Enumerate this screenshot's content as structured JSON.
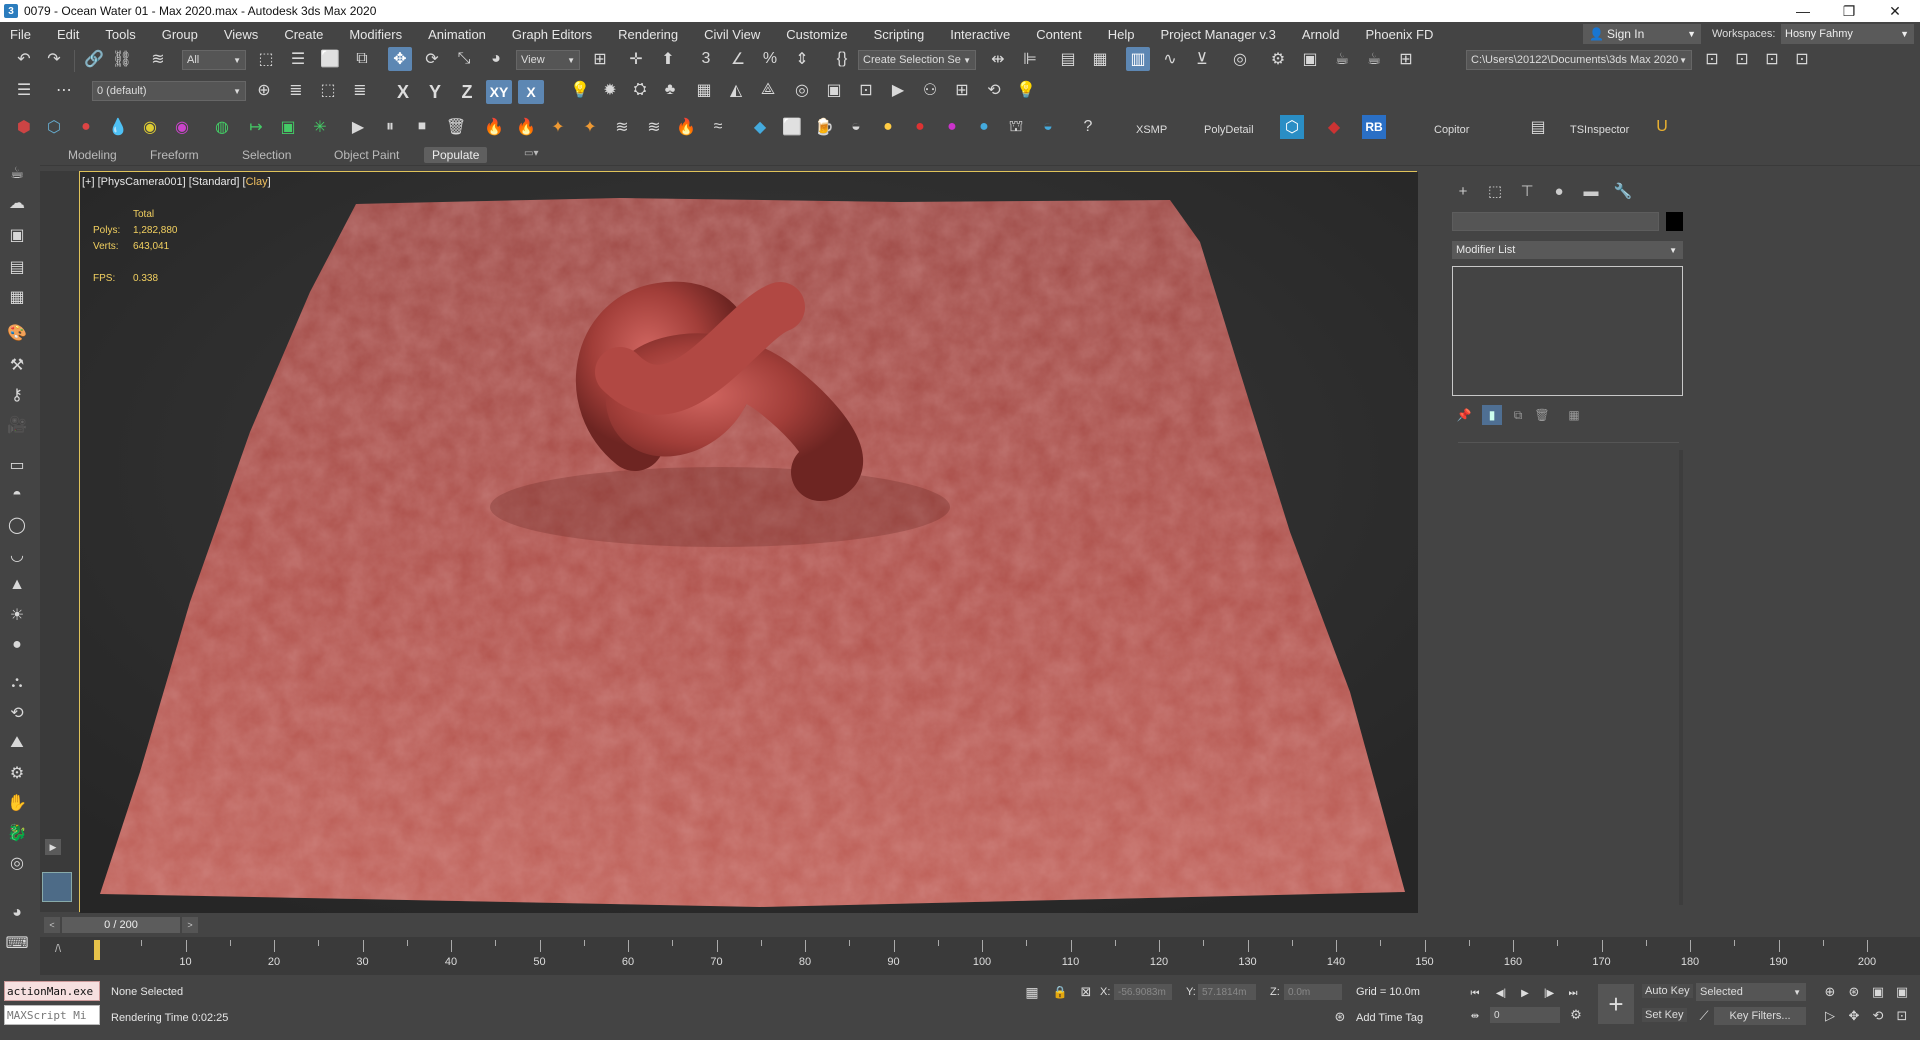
{
  "window": {
    "title": "0079 - Ocean Water 01 - Max 2020.max - Autodesk 3ds Max 2020",
    "minimize": "—",
    "maximize": "❐",
    "close": "✕"
  },
  "menu": [
    "File",
    "Edit",
    "Tools",
    "Group",
    "Views",
    "Create",
    "Modifiers",
    "Animation",
    "Graph Editors",
    "Rendering",
    "Civil View",
    "Customize",
    "Scripting",
    "Interactive",
    "Content",
    "Help",
    "Project Manager v.3",
    "Arnold",
    "Phoenix FD"
  ],
  "account": {
    "sign_in": "Sign In",
    "workspaces_label": "Workspaces:",
    "workspace_value": "Hosny Fahmy"
  },
  "main_toolbar": {
    "selection_filter": "All",
    "ref_coord": "View",
    "named_selection": "Create Selection Se",
    "project_path": "C:\\Users\\20122\\Documents\\3ds Max 2020"
  },
  "layer_toolbar": {
    "layer_name": "0 (default)",
    "axis_x": "X",
    "axis_y": "Y",
    "axis_z": "Z",
    "axis_xy": "XY",
    "axis_xz": "X"
  },
  "plugin_toolbar": {
    "xsmp": "XSMP",
    "polydetail": "PolyDetail",
    "rb": "RB",
    "copitor": "Copitor",
    "tsinspector": "TSInspector"
  },
  "ribbon_tabs": [
    "Modeling",
    "Freeform",
    "Selection",
    "Object Paint",
    "Populate"
  ],
  "ribbon_active": "Populate",
  "viewport": {
    "label_prefix": "[+] [PhysCamera001] [Standard] [",
    "label_mode": "Clay",
    "label_suffix": "]",
    "stats": {
      "header": "Total",
      "polys_label": "Polys:",
      "polys": "1,282,880",
      "verts_label": "Verts:",
      "verts": "643,041",
      "fps_label": "FPS:",
      "fps": "0.338"
    },
    "terrain_color": "#b24a45",
    "knot_color": "#a83f3a"
  },
  "command_panel": {
    "modifier_list": "Modifier List"
  },
  "timeline": {
    "slider_text": "0 / 200",
    "ticks": [
      "10",
      "20",
      "30",
      "40",
      "50",
      "60",
      "70",
      "80",
      "90",
      "100",
      "110",
      "120",
      "130",
      "140",
      "150",
      "160",
      "170",
      "180",
      "190",
      "200"
    ]
  },
  "status": {
    "maxscript_1": "actionMan.exe",
    "maxscript_2": "MAXScript Mi",
    "selection": "None Selected",
    "render_time": "Rendering Time  0:02:25",
    "x_label": "X:",
    "x_value": "-56.9083m",
    "y_label": "Y:",
    "y_value": "57.1814m",
    "z_label": "Z:",
    "z_value": "0.0m",
    "grid": "Grid = 10.0m",
    "add_time_tag": "Add Time Tag",
    "auto_key": "Auto Key",
    "set_key": "Set Key",
    "selected": "Selected",
    "frame": "0",
    "key_filters": "Key Filters..."
  }
}
